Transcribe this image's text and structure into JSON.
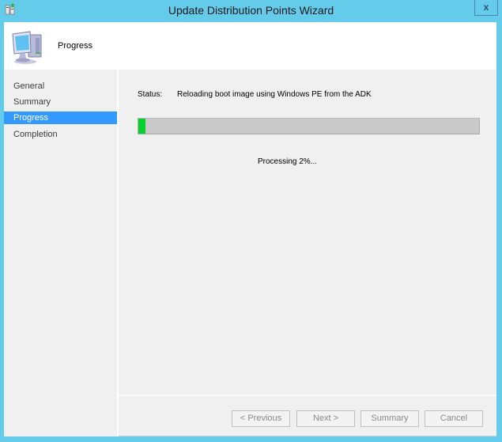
{
  "window": {
    "title": "Update Distribution Points Wizard",
    "app_icon": "wizard-app-icon",
    "close_label": "x"
  },
  "header": {
    "icon": "computer-icon",
    "title": "Progress"
  },
  "nav": {
    "items": [
      {
        "label": "General",
        "selected": false
      },
      {
        "label": "Summary",
        "selected": false
      },
      {
        "label": "Progress",
        "selected": true
      },
      {
        "label": "Completion",
        "selected": false
      }
    ]
  },
  "main": {
    "status_label": "Status:",
    "status_value": "Reloading boot image using Windows PE from the ADK",
    "progress_percent": 2,
    "progress_text": "Processing 2%..."
  },
  "footer": {
    "buttons": [
      {
        "label": "< Previous",
        "enabled": false
      },
      {
        "label": "Next >",
        "enabled": false
      },
      {
        "label": "Summary",
        "enabled": false
      },
      {
        "label": "Cancel",
        "enabled": false
      }
    ]
  },
  "colors": {
    "frame": "#65cbea",
    "selected_nav": "#3399ff",
    "progress_fill": "#06d02a",
    "progress_track": "#c9c9c9"
  }
}
